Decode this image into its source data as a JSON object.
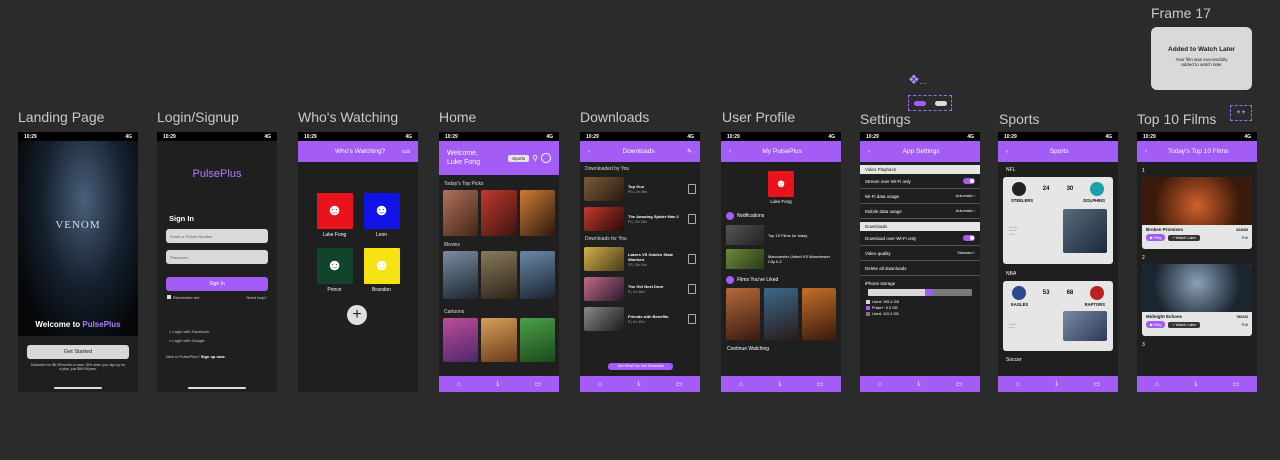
{
  "frames": {
    "landing": "Landing Page",
    "login": "Login/Signup",
    "who": "Who's Watching",
    "home": "Home",
    "downloads": "Downloads",
    "profile": "User Profile",
    "settings": "Settings",
    "sports": "Sports",
    "top10": "Top 10 Films",
    "frame17": "Frame 17"
  },
  "status": {
    "time": "10:29",
    "signal": "4G"
  },
  "landing": {
    "movie": "VENOM",
    "welcome_prefix": "Welcome to ",
    "brand": "PulsePlus",
    "cta": "Get Started",
    "fine_print": "Subscribe for $6.99/month or save 15% when you sign up for a plan, just $59.99/year."
  },
  "login": {
    "brand": "PulsePlus",
    "heading": "Sign In",
    "email_placeholder": "Email or Phone Number",
    "password_placeholder": "Password",
    "signin": "Sign In",
    "remember": "Remember me",
    "help": "Need help?",
    "facebook": "Login with Facebook",
    "google": "Login with Google",
    "new_prefix": "New to PulsePlus? ",
    "signup": "Sign up now."
  },
  "who": {
    "title": "Who's Watching?",
    "edit": "Edit",
    "profiles": [
      {
        "name": "Luke Fong",
        "color": "#e8131c"
      },
      {
        "name": "Leon",
        "color": "#1213e6"
      },
      {
        "name": "Prince",
        "color": "#11442b"
      },
      {
        "name": "Brandon",
        "color": "#f7e214"
      }
    ],
    "add": "+"
  },
  "home": {
    "welcome": "Welcome, Luke Fong",
    "chip": "Sports",
    "sections": [
      "Today's Top Picks",
      "Movies",
      "Cartoons"
    ]
  },
  "downloads": {
    "title": "Downloads",
    "sec1": "Downloaded by You",
    "sec2": "Downloads for You",
    "items": [
      {
        "title": "Top Gun",
        "meta": "PG | 1hr 49m"
      },
      {
        "title": "The Amazing Spider Man 2",
        "meta": "PG | 2hr 22m"
      },
      {
        "title": "Lakers VS Golden State Warriors",
        "meta": "PG | 3hr 11m"
      },
      {
        "title": "The Girl Next Door",
        "meta": "R | 1hr 48m"
      },
      {
        "title": "Friends with Benefits",
        "meta": "R | 1hr 49m"
      }
    ],
    "button": "See What You Can Download"
  },
  "profile": {
    "title": "My PulsePlus",
    "name": "Luke Fong",
    "notif": "Notifications",
    "n1": "Top 10 Films for today",
    "n2": "Manchester United VS Manchester City 0-2",
    "liked": "Films You've Liked",
    "continue": "Continue Watching"
  },
  "settings": {
    "title": "App Settings",
    "video": "Video Playback",
    "wifi_only": "Stream over Wi-Fi only",
    "wifi_data": "Wi-Fi data usage",
    "mobile_data": "Mobile data usage",
    "auto": "Automatic",
    "dl": "Downloads",
    "dl_wifi": "Download over Wi-Fi only",
    "quality": "Video quality",
    "standard": "Standard",
    "delete": "Delete all downloads",
    "storage": "iPhone storage",
    "legend": [
      "Used: 195.4 GB",
      "Pulse+: 5.0 GB",
      "Used: 115.3 GB"
    ],
    "storage_fill": 0.55
  },
  "sports": {
    "title": "Sports",
    "nfl": "NFL",
    "nba": "NBA",
    "soccer": "Soccer",
    "g1": {
      "home": "STEELERS",
      "hs": "24",
      "as": "30",
      "away": "DOLPHINS"
    },
    "g2": {
      "home": "EAGLES",
      "hs": "53",
      "as": "68",
      "away": "RAPTORS"
    }
  },
  "top10": {
    "title": "Today's Top 10 Films",
    "n1": "1",
    "n2": "2",
    "n3": "3",
    "f1": {
      "name": "Broken Promises",
      "views": "823065",
      "rating": "R16"
    },
    "f2": {
      "name": "Midnight Echoes",
      "views": "780233",
      "rating": "R18"
    },
    "play": "Play",
    "later": "Watch Later"
  },
  "toast": {
    "title": "Added to Watch Later",
    "body": "Your film was successfully added to watch later"
  },
  "colors": {
    "accent": "#a35cf5",
    "bg": "#2b2b2b"
  }
}
